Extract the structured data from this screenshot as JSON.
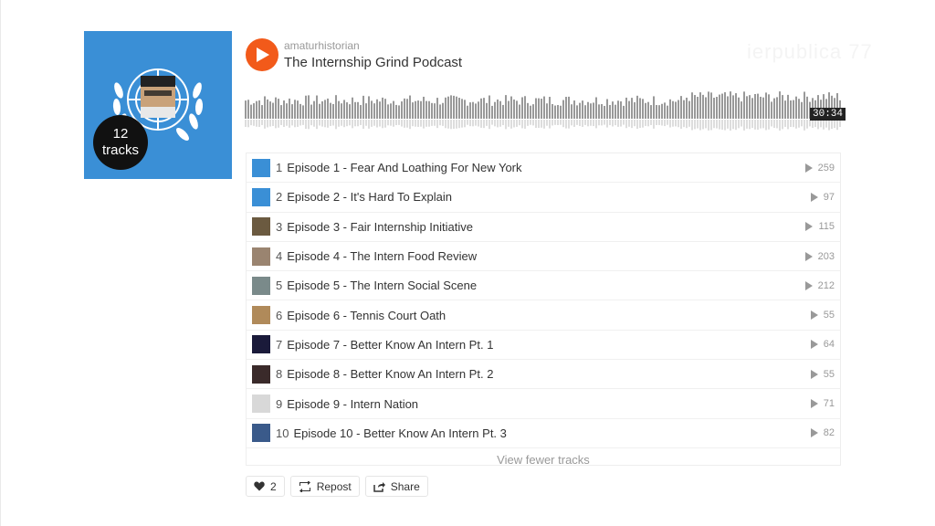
{
  "playlist": {
    "uploader": "amaturhistorian",
    "title": "The Internship Grind Podcast",
    "track_count_number": "12",
    "track_count_label": "tracks",
    "duration": "30:34",
    "watermark": "ierpublica 77"
  },
  "tracks": [
    {
      "num": "1",
      "title": "Episode 1 - Fear And Loathing For New York",
      "plays": "259",
      "thumb_color": "#3a8fd6"
    },
    {
      "num": "2",
      "title": "Episode 2 - It's Hard To Explain",
      "plays": "97",
      "thumb_color": "#3a8fd6"
    },
    {
      "num": "3",
      "title": "Episode 3 - Fair Internship Initiative",
      "plays": "115",
      "thumb_color": "#6b5a40"
    },
    {
      "num": "4",
      "title": "Episode 4 - The Intern Food Review",
      "plays": "203",
      "thumb_color": "#9a8470"
    },
    {
      "num": "5",
      "title": "Episode 5 - The Intern Social Scene",
      "plays": "212",
      "thumb_color": "#7a8a8a"
    },
    {
      "num": "6",
      "title": "Episode 6 - Tennis Court Oath",
      "plays": "55",
      "thumb_color": "#b08a5a"
    },
    {
      "num": "7",
      "title": "Episode 7 - Better Know An Intern Pt. 1",
      "plays": "64",
      "thumb_color": "#1a1a3a"
    },
    {
      "num": "8",
      "title": "Episode 8 - Better Know An Intern Pt. 2",
      "plays": "55",
      "thumb_color": "#3a2a2a"
    },
    {
      "num": "9",
      "title": "Episode 9 - Intern Nation",
      "plays": "71",
      "thumb_color": "#d8d8d8"
    },
    {
      "num": "10",
      "title": "Episode 10 - Better Know An Intern Pt. 3",
      "plays": "82",
      "thumb_color": "#3a5a8a"
    }
  ],
  "list_footer": {
    "view_fewer": "View fewer tracks"
  },
  "actions": {
    "like_count": "2",
    "repost_label": "Repost",
    "share_label": "Share"
  },
  "colors": {
    "accent": "#f25a1a",
    "artwork_bg": "#3a8fd6",
    "waveform": "#999999"
  }
}
